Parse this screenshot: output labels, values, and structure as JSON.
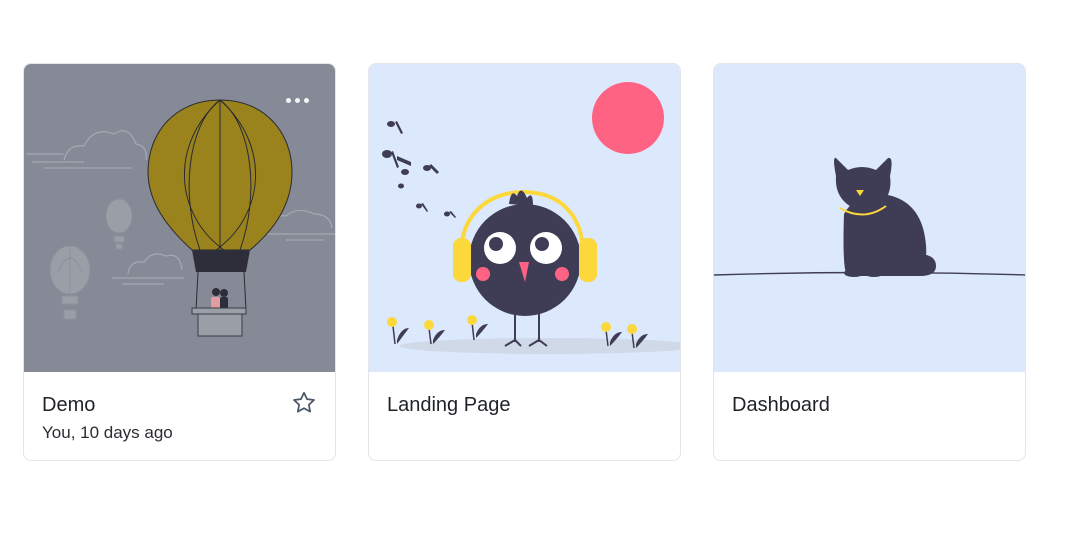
{
  "cards": [
    {
      "title": "Demo",
      "meta": "You, 10 days ago",
      "thumbnail_icon": "hot-air-balloon-illustration",
      "thumbnail_bg": "#858a96",
      "has_menu": true,
      "has_star": true
    },
    {
      "title": "Landing Page",
      "thumbnail_icon": "bird-with-headphones-illustration",
      "thumbnail_bg": "#dce8fc"
    },
    {
      "title": "Dashboard",
      "thumbnail_icon": "cat-on-wire-illustration",
      "thumbnail_bg": "#dce8fc"
    }
  ],
  "colors": {
    "accent_yellow": "#fcd83b",
    "accent_pink": "#ff6384",
    "illustration_dark": "#3f3d56",
    "balloon_olive": "#9a831d"
  }
}
